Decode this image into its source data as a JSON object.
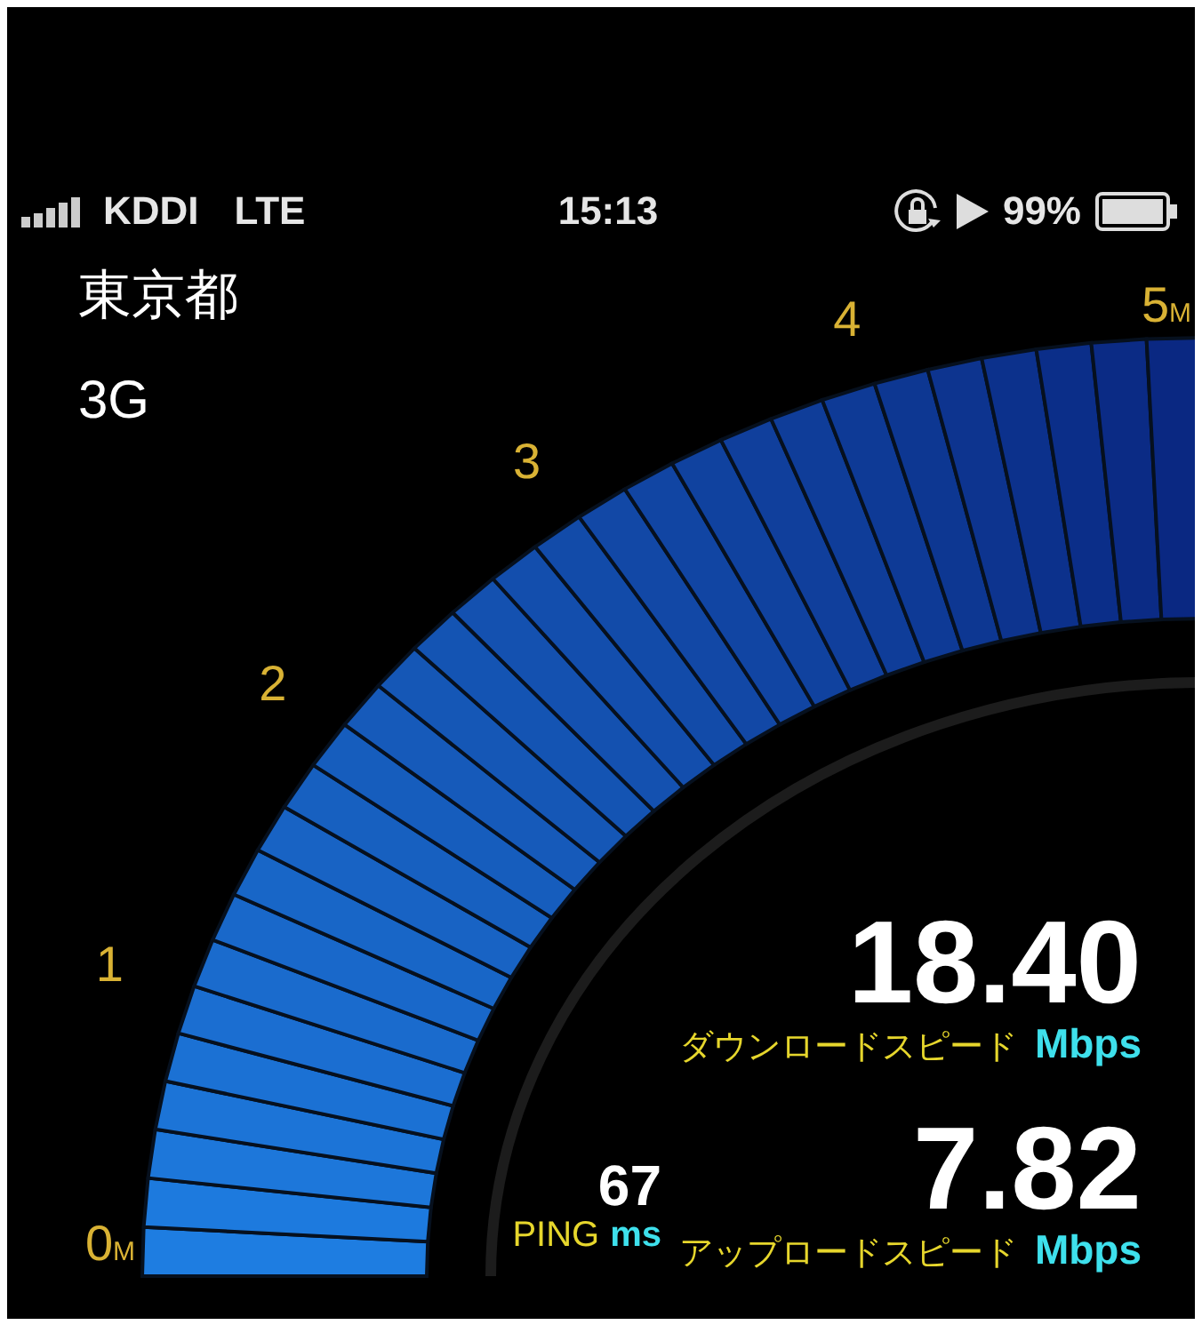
{
  "status_bar": {
    "carrier": "KDDI",
    "network": "LTE",
    "time": "15:13",
    "battery_text": "99%"
  },
  "location": {
    "region": "東京都",
    "connection": "3G"
  },
  "gauge": {
    "scale_labels": [
      {
        "text": "0",
        "unit": "M"
      },
      {
        "text": "1"
      },
      {
        "text": "2"
      },
      {
        "text": "3"
      },
      {
        "text": "4"
      },
      {
        "text": "5",
        "unit": "M"
      }
    ]
  },
  "download": {
    "value": "18.40",
    "label": "ダウンロードスピード",
    "unit": "Mbps"
  },
  "upload": {
    "value": "7.82",
    "label": "アップロードスピード",
    "unit": "Mbps"
  },
  "ping": {
    "value": "67",
    "label": "PING",
    "unit": "ms"
  }
}
